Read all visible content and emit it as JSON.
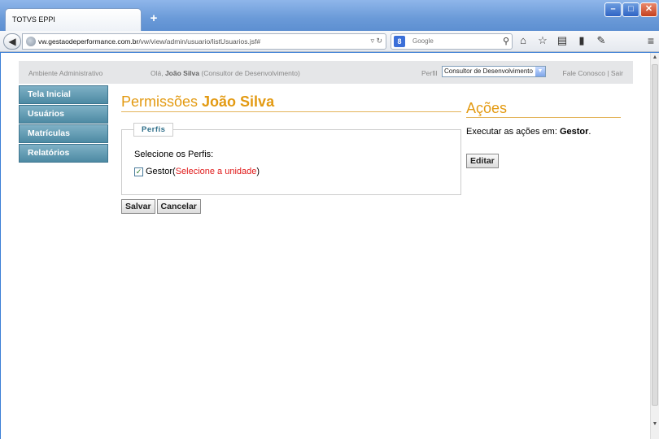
{
  "browser": {
    "tab_title": "TOTVS EPPI",
    "new_tab": "+",
    "url_host": "vw.gestaodeperformance.com.br",
    "url_path": "/vw/view/admin/usuario/listUsuarios.jsf#",
    "search_placeholder": "Google",
    "search_engine_icon": "8"
  },
  "topbar": {
    "environment": "Ambiente Administrativo",
    "greeting_prefix": "Olá, ",
    "user_name": "João Silva",
    "user_role": " (Consultor de Desenvolvimento)",
    "perfil_label": "Perfil",
    "perfil_value": "Consultor de Desenvolvimento",
    "links": "Fale Conosco | Sair"
  },
  "sidebar": {
    "items": [
      {
        "label": "Tela Inicial"
      },
      {
        "label": "Usuários"
      },
      {
        "label": "Matrículas"
      },
      {
        "label": "Relatórios"
      }
    ]
  },
  "main": {
    "title_prefix": "Permissões ",
    "title_name": "João Silva",
    "legend": "Perfis",
    "select_label": "Selecione os Perfis:",
    "profile": "Gestor",
    "profile_open": " ( ",
    "profile_hint": "Selecione a unidade",
    "profile_close": ")",
    "save_label": "Salvar",
    "cancel_label": "Cancelar"
  },
  "actions": {
    "title": "Ações",
    "text_prefix": "Executar as ações em: ",
    "text_target": "Gestor",
    "text_suffix": ".",
    "edit_label": "Editar"
  }
}
